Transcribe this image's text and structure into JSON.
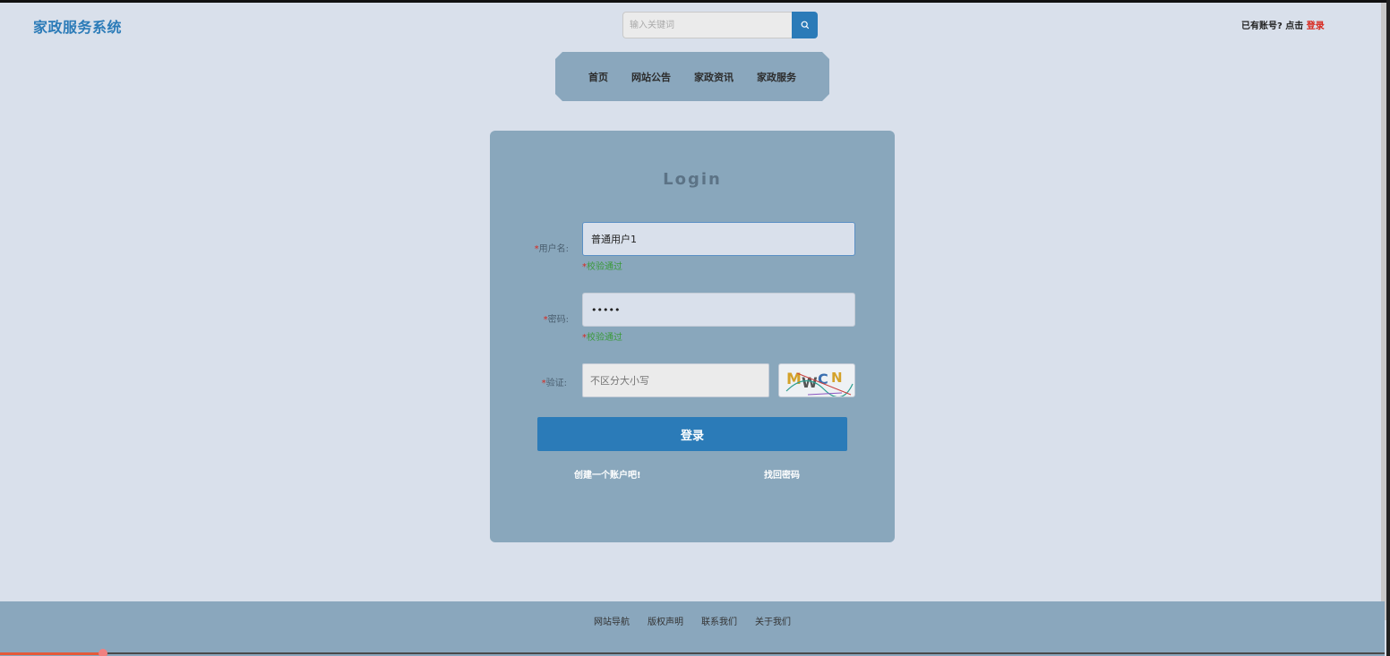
{
  "header": {
    "brand": "家政服务系统",
    "search": {
      "placeholder": "输入关键词",
      "value": ""
    },
    "account_prompt": "已有账号? 点击",
    "login_link": "登录"
  },
  "nav": {
    "items": [
      {
        "label": "首页"
      },
      {
        "label": "网站公告"
      },
      {
        "label": "家政资讯"
      },
      {
        "label": "家政服务"
      }
    ]
  },
  "login": {
    "title": "Login",
    "username": {
      "label": "用户名",
      "value": "普通用户1",
      "status": "校验通过"
    },
    "password": {
      "label": "密码",
      "value": "•••••",
      "status": "校验通过"
    },
    "captcha": {
      "label": "验证",
      "placeholder": "不区分大小写",
      "image_text": "MWCN"
    },
    "submit_label": "登录",
    "register_link": "创建一个账户吧!",
    "forgot_link": "找回密码"
  },
  "footer": {
    "links": [
      {
        "label": "网站导航"
      },
      {
        "label": "版权声明"
      },
      {
        "label": "联系我们"
      },
      {
        "label": "关于我们"
      }
    ]
  },
  "colors": {
    "page_bg": "#d9e0eb",
    "panel": "#8aa7bd",
    "accent": "#2b7bb8",
    "required": "#d8281e",
    "success": "#3a9a3a"
  }
}
